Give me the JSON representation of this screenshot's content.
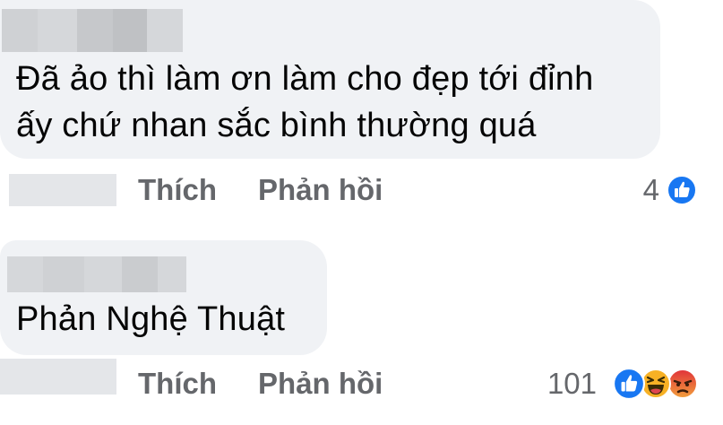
{
  "comments": [
    {
      "text_line1": "Đã ảo thì làm ơn làm cho đẹp tới đỉnh",
      "text_line2": "ấy chứ nhan sắc bình thường quá",
      "like_label": "Thích",
      "reply_label": "Phản hồi",
      "reaction_count": "4",
      "reactions": [
        "like-icon"
      ]
    },
    {
      "text_line1": "Phản Nghệ Thuật",
      "like_label": "Thích",
      "reply_label": "Phản hồi",
      "reaction_count": "101",
      "reactions": [
        "like-icon",
        "haha-icon",
        "angry-icon"
      ]
    }
  ],
  "colors": {
    "bubble": "#f0f2f5",
    "text": "#050505",
    "action": "#65676b",
    "like_blue": "#1877f2",
    "haha_yellow": "#f7b125",
    "angry_orange": "#e9710f"
  }
}
